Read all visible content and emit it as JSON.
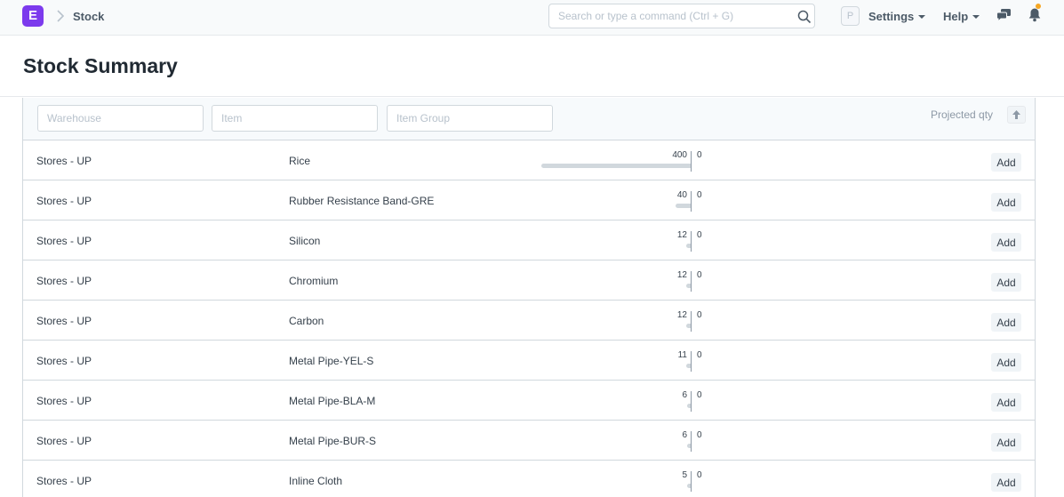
{
  "navbar": {
    "logo_letter": "E",
    "breadcrumb": "Stock",
    "search_placeholder": "Search or type a command (Ctrl + G)",
    "avatar_letter": "P",
    "settings_label": "Settings",
    "help_label": "Help",
    "icons": [
      "chevron-right-icon",
      "search-icon",
      "chat-icon",
      "bell-icon"
    ],
    "notification_dot_color": "#f6a723",
    "logo_color": "#7c3aed"
  },
  "page": {
    "title": "Stock Summary"
  },
  "filters": {
    "warehouse_placeholder": "Warehouse",
    "item_placeholder": "Item",
    "item_group_placeholder": "Item Group",
    "sort_label": "Projected qty",
    "max_qty": 400
  },
  "rows": [
    {
      "warehouse": "Stores - UP",
      "item": "Rice",
      "qty": "400",
      "zero": "0",
      "qty_value": 400,
      "add_label": "Add"
    },
    {
      "warehouse": "Stores - UP",
      "item": "Rubber Resistance Band-GRE",
      "qty": "40",
      "zero": "0",
      "qty_value": 40,
      "add_label": "Add"
    },
    {
      "warehouse": "Stores - UP",
      "item": "Silicon",
      "qty": "12",
      "zero": "0",
      "qty_value": 12,
      "add_label": "Add"
    },
    {
      "warehouse": "Stores - UP",
      "item": "Chromium",
      "qty": "12",
      "zero": "0",
      "qty_value": 12,
      "add_label": "Add"
    },
    {
      "warehouse": "Stores - UP",
      "item": "Carbon",
      "qty": "12",
      "zero": "0",
      "qty_value": 12,
      "add_label": "Add"
    },
    {
      "warehouse": "Stores - UP",
      "item": "Metal Pipe-YEL-S",
      "qty": "11",
      "zero": "0",
      "qty_value": 11,
      "add_label": "Add"
    },
    {
      "warehouse": "Stores - UP",
      "item": "Metal Pipe-BLA-M",
      "qty": "6",
      "zero": "0",
      "qty_value": 6,
      "add_label": "Add"
    },
    {
      "warehouse": "Stores - UP",
      "item": "Metal Pipe-BUR-S",
      "qty": "6",
      "zero": "0",
      "qty_value": 6,
      "add_label": "Add"
    },
    {
      "warehouse": "Stores - UP",
      "item": "Inline Cloth",
      "qty": "5",
      "zero": "0",
      "qty_value": 5,
      "add_label": "Add"
    }
  ]
}
